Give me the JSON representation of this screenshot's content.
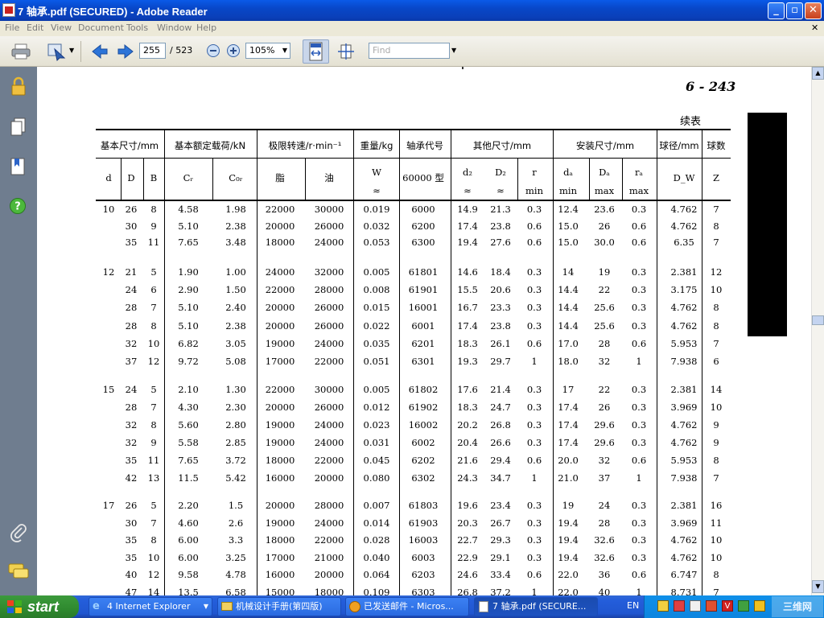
{
  "window": {
    "title": "7  轴承.pdf (SECURED) - Adobe Reader",
    "minimize": "_",
    "maximize": "▫",
    "close": "✕"
  },
  "menu": [
    "File",
    "Edit",
    "View",
    "Document",
    "Tools",
    "Window",
    "Help"
  ],
  "menu_close": "✕",
  "toolbar": {
    "page_current": "255",
    "page_total": "/ 523",
    "zoom": "105%",
    "find_placeholder": "Find"
  },
  "pdf": {
    "page_number": "6 - 243",
    "continued": "续表",
    "header_top": [
      "基本尺寸/mm",
      "基本额定载荷/kN",
      "极限转速/r·min⁻¹",
      "重量/kg",
      "轴承代号",
      "其他尺寸/mm",
      "安装尺寸/mm",
      "球径/mm",
      "球数"
    ],
    "header_sub": [
      {
        "t": "d",
        "s": ""
      },
      {
        "t": "D",
        "s": ""
      },
      {
        "t": "B",
        "s": ""
      },
      {
        "t": "Cᵣ",
        "s": ""
      },
      {
        "t": "C₀ᵣ",
        "s": ""
      },
      {
        "t": "脂",
        "s": ""
      },
      {
        "t": "油",
        "s": ""
      },
      {
        "t": "W",
        "s": "≈"
      },
      {
        "t": "60000 型",
        "s": ""
      },
      {
        "t": "d₂",
        "s": "≈"
      },
      {
        "t": "D₂",
        "s": "≈"
      },
      {
        "t": "r",
        "s": "min"
      },
      {
        "t": "dₐ",
        "s": "min"
      },
      {
        "t": "Dₐ",
        "s": "max"
      },
      {
        "t": "rₐ",
        "s": "max"
      },
      {
        "t": "D_W",
        "s": ""
      },
      {
        "t": "Z",
        "s": ""
      }
    ],
    "groups": [
      {
        "d": "10",
        "rows": [
          [
            "26",
            "8",
            "4.58",
            "1.98",
            "22000",
            "30000",
            "0.019",
            "6000",
            "14.9",
            "21.3",
            "0.3",
            "12.4",
            "23.6",
            "0.3",
            "4.762",
            "7"
          ],
          [
            "30",
            "9",
            "5.10",
            "2.38",
            "20000",
            "26000",
            "0.032",
            "6200",
            "17.4",
            "23.8",
            "0.6",
            "15.0",
            "26",
            "0.6",
            "4.762",
            "8"
          ],
          [
            "35",
            "11",
            "7.65",
            "3.48",
            "18000",
            "24000",
            "0.053",
            "6300",
            "19.4",
            "27.6",
            "0.6",
            "15.0",
            "30.0",
            "0.6",
            "6.35",
            "7"
          ]
        ]
      },
      {
        "d": "12",
        "rows": [
          [
            "21",
            "5",
            "1.90",
            "1.00",
            "24000",
            "32000",
            "0.005",
            "61801",
            "14.6",
            "18.4",
            "0.3",
            "14",
            "19",
            "0.3",
            "2.381",
            "12"
          ],
          [
            "24",
            "6",
            "2.90",
            "1.50",
            "22000",
            "28000",
            "0.008",
            "61901",
            "15.5",
            "20.6",
            "0.3",
            "14.4",
            "22",
            "0.3",
            "3.175",
            "10"
          ],
          [
            "28",
            "7",
            "5.10",
            "2.40",
            "20000",
            "26000",
            "0.015",
            "16001",
            "16.7",
            "23.3",
            "0.3",
            "14.4",
            "25.6",
            "0.3",
            "4.762",
            "8"
          ],
          [
            "28",
            "8",
            "5.10",
            "2.38",
            "20000",
            "26000",
            "0.022",
            "6001",
            "17.4",
            "23.8",
            "0.3",
            "14.4",
            "25.6",
            "0.3",
            "4.762",
            "8"
          ],
          [
            "32",
            "10",
            "6.82",
            "3.05",
            "19000",
            "24000",
            "0.035",
            "6201",
            "18.3",
            "26.1",
            "0.6",
            "17.0",
            "28",
            "0.6",
            "5.953",
            "7"
          ],
          [
            "37",
            "12",
            "9.72",
            "5.08",
            "17000",
            "22000",
            "0.051",
            "6301",
            "19.3",
            "29.7",
            "1",
            "18.0",
            "32",
            "1",
            "7.938",
            "6"
          ]
        ]
      },
      {
        "d": "15",
        "rows": [
          [
            "24",
            "5",
            "2.10",
            "1.30",
            "22000",
            "30000",
            "0.005",
            "61802",
            "17.6",
            "21.4",
            "0.3",
            "17",
            "22",
            "0.3",
            "2.381",
            "14"
          ],
          [
            "28",
            "7",
            "4.30",
            "2.30",
            "20000",
            "26000",
            "0.012",
            "61902",
            "18.3",
            "24.7",
            "0.3",
            "17.4",
            "26",
            "0.3",
            "3.969",
            "10"
          ],
          [
            "32",
            "8",
            "5.60",
            "2.80",
            "19000",
            "24000",
            "0.023",
            "16002",
            "20.2",
            "26.8",
            "0.3",
            "17.4",
            "29.6",
            "0.3",
            "4.762",
            "9"
          ],
          [
            "32",
            "9",
            "5.58",
            "2.85",
            "19000",
            "24000",
            "0.031",
            "6002",
            "20.4",
            "26.6",
            "0.3",
            "17.4",
            "29.6",
            "0.3",
            "4.762",
            "9"
          ],
          [
            "35",
            "11",
            "7.65",
            "3.72",
            "18000",
            "22000",
            "0.045",
            "6202",
            "21.6",
            "29.4",
            "0.6",
            "20.0",
            "32",
            "0.6",
            "5.953",
            "8"
          ],
          [
            "42",
            "13",
            "11.5",
            "5.42",
            "16000",
            "20000",
            "0.080",
            "6302",
            "24.3",
            "34.7",
            "1",
            "21.0",
            "37",
            "1",
            "7.938",
            "7"
          ]
        ]
      },
      {
        "d": "17",
        "rows": [
          [
            "26",
            "5",
            "2.20",
            "1.5",
            "20000",
            "28000",
            "0.007",
            "61803",
            "19.6",
            "23.4",
            "0.3",
            "19",
            "24",
            "0.3",
            "2.381",
            "16"
          ],
          [
            "30",
            "7",
            "4.60",
            "2.6",
            "19000",
            "24000",
            "0.014",
            "61903",
            "20.3",
            "26.7",
            "0.3",
            "19.4",
            "28",
            "0.3",
            "3.969",
            "11"
          ],
          [
            "35",
            "8",
            "6.00",
            "3.3",
            "18000",
            "22000",
            "0.028",
            "16003",
            "22.7",
            "29.3",
            "0.3",
            "19.4",
            "32.6",
            "0.3",
            "4.762",
            "10"
          ],
          [
            "35",
            "10",
            "6.00",
            "3.25",
            "17000",
            "21000",
            "0.040",
            "6003",
            "22.9",
            "29.1",
            "0.3",
            "19.4",
            "32.6",
            "0.3",
            "4.762",
            "10"
          ],
          [
            "40",
            "12",
            "9.58",
            "4.78",
            "16000",
            "20000",
            "0.064",
            "6203",
            "24.6",
            "33.4",
            "0.6",
            "22.0",
            "36",
            "0.6",
            "6.747",
            "8"
          ],
          [
            "47",
            "14",
            "13.5",
            "6.58",
            "15000",
            "18000",
            "0.109",
            "6303",
            "26.8",
            "37.2",
            "1",
            "22.0",
            "40",
            "1",
            "8.731",
            "7"
          ]
        ]
      }
    ]
  },
  "taskbar": {
    "start": "start",
    "tasks": [
      "4 Internet Explorer",
      "机械设计手册(第四版)",
      "已发送邮件 - Micros...",
      "7  轴承.pdf (SECURE..."
    ],
    "tray_lang": "EN",
    "watermark": "三维网"
  }
}
